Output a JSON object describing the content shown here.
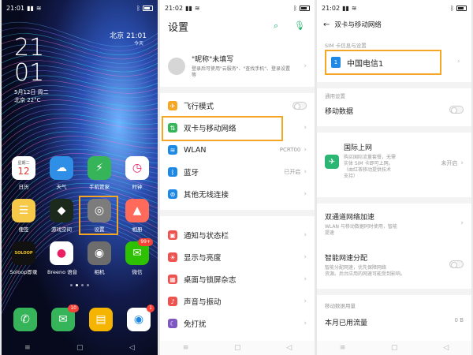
{
  "home": {
    "status_time": "21:01",
    "clock_hour": "21",
    "clock_minute": "01",
    "date": "5月12日 周二",
    "temperature": "北京 22°C",
    "city": "北京",
    "city_time": "21:01",
    "city_sub": "今天",
    "apps": [
      {
        "name": "日历",
        "icon": "calendar-icon",
        "color": "#ffffff",
        "glyph": "12",
        "glyph_top": "星期二"
      },
      {
        "name": "天气",
        "icon": "weather-icon",
        "color": "#2f8fe6",
        "glyph": "☁"
      },
      {
        "name": "手机管家",
        "icon": "phone-manager-icon",
        "color": "#35b45a",
        "glyph": "⚡"
      },
      {
        "name": "时钟",
        "icon": "clock-icon",
        "color": "#ffffff",
        "glyph": "◷"
      },
      {
        "name": "便签",
        "icon": "notes-icon",
        "color": "#f7c948",
        "glyph": "☰"
      },
      {
        "name": "游戏空间",
        "icon": "game-space-icon",
        "color": "#1b2a1b",
        "glyph": "◆"
      },
      {
        "name": "设置",
        "icon": "settings-icon",
        "color": "#7c7c7c",
        "glyph": "◎"
      },
      {
        "name": "相册",
        "icon": "gallery-icon",
        "color": "#ff6a5a",
        "glyph": "▲"
      },
      {
        "name": "Soloop即录",
        "icon": "soloop-icon",
        "color": "#111111",
        "glyph": "SOLOOP"
      },
      {
        "name": "Breeno 语音",
        "icon": "breeno-icon",
        "color": "#ffffff",
        "glyph": "●"
      },
      {
        "name": "相机",
        "icon": "camera-icon",
        "color": "#6d6d6d",
        "glyph": "◉"
      },
      {
        "name": "微信",
        "icon": "wechat-icon",
        "color": "#2dc100",
        "glyph": "✉",
        "badge": "99+"
      }
    ],
    "dock": [
      {
        "icon": "phone-icon",
        "color": "#35b45a",
        "glyph": "✆"
      },
      {
        "icon": "messages-icon",
        "color": "#35b45a",
        "glyph": "✉",
        "badge": "10"
      },
      {
        "icon": "files-icon",
        "color": "#f4b400",
        "glyph": "▤"
      },
      {
        "icon": "browser-icon",
        "color": "#ffffff",
        "glyph": "◉",
        "badge": "1"
      }
    ]
  },
  "settings": {
    "status_time": "21:02",
    "title": "设置",
    "account_name": "\"昵称\"未填写",
    "account_sub_1": "登录后可使用\"云服务\"、\"查找手机\"、登录设置",
    "account_sub_2": "等",
    "rows": [
      {
        "label": "飞行模式",
        "icon": "airplane-icon",
        "color": "#f5a623",
        "glyph": "✈",
        "control": "toggle"
      },
      {
        "label": "双卡与移动网络",
        "icon": "dual-sim-icon",
        "color": "#35b45a",
        "glyph": "⇅"
      },
      {
        "label": "WLAN",
        "icon": "wifi-icon",
        "color": "#1e88e5",
        "glyph": "≋",
        "value": "PCRT00"
      },
      {
        "label": "蓝牙",
        "icon": "bluetooth-icon",
        "color": "#1e88e5",
        "glyph": "ᛒ",
        "value": "已开启"
      },
      {
        "label": "其他无线连接",
        "icon": "wireless-icon",
        "color": "#1e88e5",
        "glyph": "⊚"
      },
      {
        "label": "通知与状态栏",
        "icon": "notification-icon",
        "color": "#ef5350",
        "glyph": "▣"
      },
      {
        "label": "显示与亮度",
        "icon": "display-icon",
        "color": "#ef5350",
        "glyph": "☀"
      },
      {
        "label": "桌面与锁屏杂志",
        "icon": "desktop-icon",
        "color": "#ef5350",
        "glyph": "▦"
      },
      {
        "label": "声音与振动",
        "icon": "sound-icon",
        "color": "#ef5350",
        "glyph": "♪"
      },
      {
        "label": "免打扰",
        "icon": "dnd-icon",
        "color": "#7e57c2",
        "glyph": "☾"
      }
    ]
  },
  "dualsim": {
    "status_time": "21:02",
    "title": "双卡与移动网络",
    "sim_section": "SIM 卡信息与设置",
    "sim_name": "中国电信1",
    "general_section": "通用设置",
    "mobile_data": "移动数据",
    "roaming_title": "国际上网",
    "roaming_desc_1": "购买国际流量套餐，无需",
    "roaming_desc_2": "实体 SIM 卡即可上网。",
    "roaming_desc_3": "（由红茶移动提供技术",
    "roaming_desc_4": "支持）",
    "roaming_value": "未开启",
    "dual_channel_title": "双通道网络加速",
    "dual_channel_desc_1": "WLAN 与移动数据同时使用，智能",
    "dual_channel_desc_2": "提速",
    "smart_title": "智能网速分配",
    "smart_desc_1": "智能分配网速，优先保障网络",
    "smart_desc_2": "资源。后台应用的网速可能受到影响。",
    "usage_section": "移动数据用量",
    "usage_title": "本月已用流量",
    "usage_value": "0 B"
  }
}
